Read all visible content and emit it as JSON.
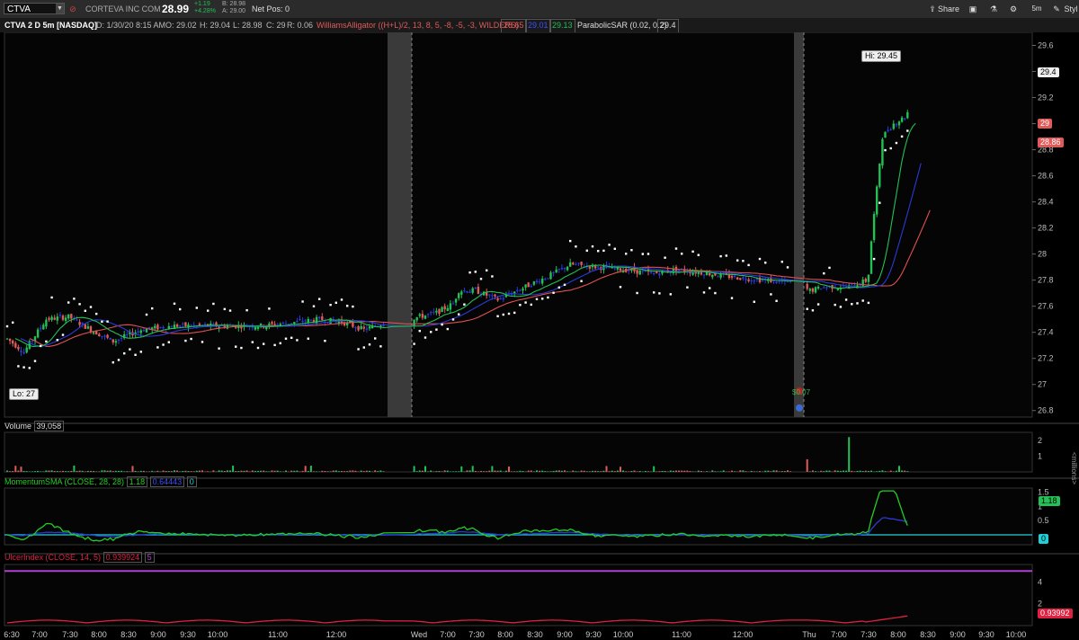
{
  "toolbar": {
    "symbol": "CTVA",
    "company": "CORTEVA INC COM",
    "last": "28.99",
    "change": "+1.19",
    "change_pct": "+4.28%",
    "bid": "B: 28.98",
    "ask": "A: 29.00",
    "netpos": "Net Pos: 0",
    "share": "Share",
    "timeframe": "5m",
    "style": "Styl"
  },
  "header": {
    "title": "CTVA 2 D 5m [NASDAQ]",
    "date": "D: 1/30/20 8:15 AM",
    "open": "O: 29.02",
    "high": "H: 29.04",
    "low": "L: 28.98",
    "close": "C: 29",
    "range": "R: 0.06",
    "alligator": "WilliamsAlligator ((H+L)/2, 13, 8, 5, -8, -5, -3, WILDERS)",
    "all_jaw": "28.65",
    "all_teeth": "29.01",
    "all_lips": "29.13",
    "psar": "ParabolicSAR (0.02, 0.2)",
    "psar_val": "29.4"
  },
  "price_pane": {
    "ticks": [
      "29.6",
      "29.4",
      "29.2",
      "29",
      "28.8",
      "28.6",
      "28.4",
      "28.2",
      "28",
      "27.8",
      "27.6",
      "27.4",
      "27.2",
      "27",
      "26.8"
    ],
    "tags": {
      "psar": "29.4",
      "last": "29",
      "jaw": "28.86"
    },
    "hi_label": "Hi: 29.45",
    "lo_label": "Lo: 27",
    "div_label": "$0.07"
  },
  "volume_pane": {
    "label": "Volume",
    "value": "39,058",
    "ticks": [
      "2",
      "1"
    ],
    "unit": "<millions>"
  },
  "momentum_pane": {
    "label": "MomentumSMA (CLOSE, 28, 28)",
    "v1": "1.18",
    "v2": "0.64443",
    "v3": "0",
    "ticks": [
      "1.5",
      "1",
      "0.5"
    ],
    "tag_mom": "1.18",
    "tag_zero": "0"
  },
  "ulcer_pane": {
    "label": "UlcerIndex (CLOSE, 14, 5)",
    "v1": "0.939924",
    "v2": "5",
    "ticks": [
      "4",
      "2"
    ],
    "tag": "0.93992"
  },
  "xaxis": {
    "ticks": [
      "6:30",
      "7:00",
      "7:30",
      "8:00",
      "8:30",
      "9:00",
      "9:30",
      "10:00",
      "11:00",
      "12:00",
      "Wed",
      "7:00",
      "7:30",
      "8:00",
      "8:30",
      "9:00",
      "9:30",
      "10:00",
      "11:00",
      "12:00",
      "Thu",
      "7:00",
      "7:30",
      "8:00",
      "8:30",
      "9:00",
      "9:30",
      "10:00"
    ]
  },
  "colors": {
    "up": "#22c055",
    "down": "#e05a5a",
    "neutral": "#2a3ad8",
    "jaw": "#e05050",
    "teeth": "#2a3ad8",
    "lips": "#22c055",
    "psar": "#ffffff",
    "momentum": "#22d022",
    "momentum_sma": "#2a3ad8",
    "zero": "#20d0d8",
    "ulcer": "#e02040",
    "ulcer_level": "#b040d0"
  },
  "chart_data": {
    "type": "candlestick",
    "symbol": "CTVA",
    "interval": "5m",
    "ylim": [
      26.75,
      29.7
    ],
    "key_levels": {
      "high": 29.45,
      "low": 27.0,
      "last": 29.0
    },
    "close_path": [
      {
        "t": 0,
        "c": 27.35
      },
      {
        "t": 0.15,
        "c": 27.25
      },
      {
        "t": 0.35,
        "c": 27.5
      },
      {
        "t": 0.55,
        "c": 27.52
      },
      {
        "t": 0.75,
        "c": 27.42
      },
      {
        "t": 0.95,
        "c": 27.33
      },
      {
        "t": 1.2,
        "c": 27.42
      },
      {
        "t": 1.5,
        "c": 27.45
      },
      {
        "t": 1.9,
        "c": 27.45
      },
      {
        "t": 2.3,
        "c": 27.45
      },
      {
        "t": 2.6,
        "c": 27.48
      },
      {
        "t": 2.8,
        "c": 27.5
      },
      {
        "t": 3.0,
        "c": 27.48
      },
      {
        "t": 3.2,
        "c": 27.42
      },
      {
        "t": 3.4,
        "c": 27.48
      },
      {
        "t": 3.6,
        "c": 27.5
      },
      {
        "t": 3.85,
        "c": 27.55
      },
      {
        "t": 4.0,
        "c": 27.62
      },
      {
        "t": 4.05,
        "c": 27.72
      },
      {
        "t": 4.2,
        "c": 27.72
      },
      {
        "t": 4.4,
        "c": 27.65
      },
      {
        "t": 4.65,
        "c": 27.75
      },
      {
        "t": 4.9,
        "c": 27.85
      },
      {
        "t": 5.05,
        "c": 27.92
      },
      {
        "t": 5.3,
        "c": 27.9
      },
      {
        "t": 5.55,
        "c": 27.88
      },
      {
        "t": 5.8,
        "c": 27.85
      },
      {
        "t": 6.0,
        "c": 27.88
      },
      {
        "t": 6.3,
        "c": 27.85
      },
      {
        "t": 6.55,
        "c": 27.82
      },
      {
        "t": 6.8,
        "c": 27.8
      },
      {
        "t": 7.0,
        "c": 27.78
      },
      {
        "t": 7.2,
        "c": 27.72
      },
      {
        "t": 7.35,
        "c": 27.75
      },
      {
        "t": 7.55,
        "c": 27.75
      },
      {
        "t": 7.72,
        "c": 27.8
      },
      {
        "t": 7.75,
        "c": 28.1
      },
      {
        "t": 7.85,
        "c": 28.9
      },
      {
        "t": 7.95,
        "c": 29.0
      },
      {
        "t": 8.05,
        "c": 29.05
      },
      {
        "t": 8.15,
        "c": 29.2
      },
      {
        "t": 8.25,
        "c": 29.38
      },
      {
        "t": 8.35,
        "c": 29.42
      },
      {
        "t": 8.45,
        "c": 29.3
      },
      {
        "t": 8.55,
        "c": 29.15
      },
      {
        "t": 8.65,
        "c": 29.05
      },
      {
        "t": 8.75,
        "c": 29.0
      }
    ],
    "volume_spike_millions": 2.2
  }
}
